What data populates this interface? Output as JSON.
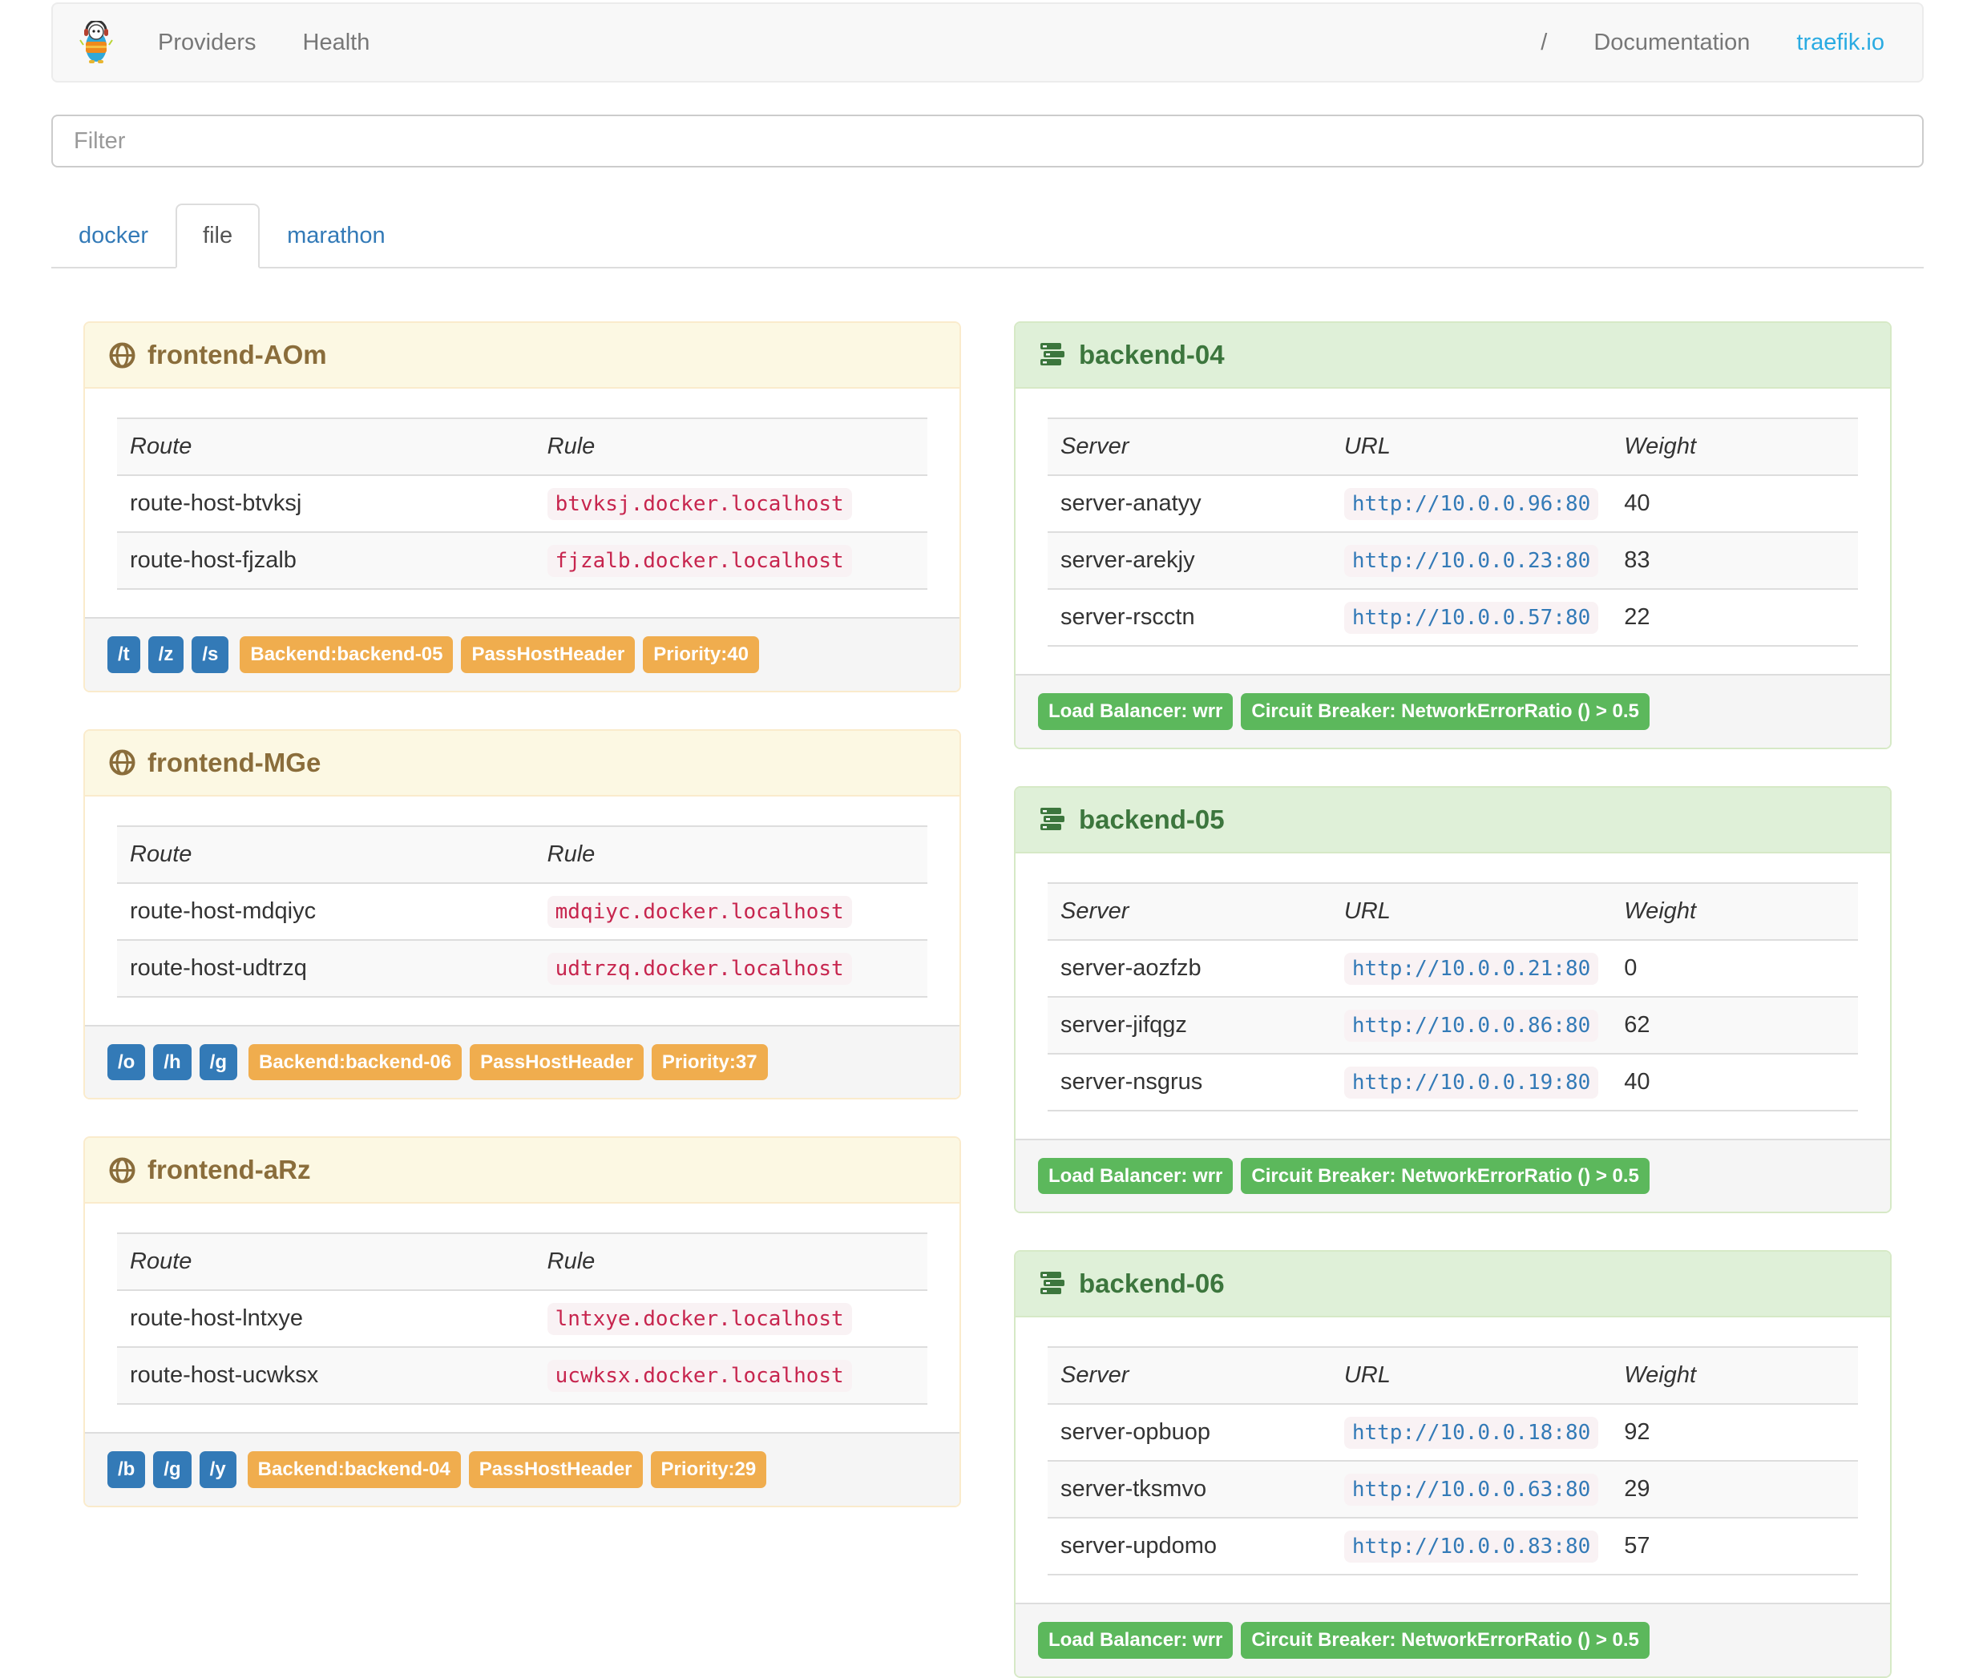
{
  "navbar": {
    "links": [
      {
        "label": "Providers"
      },
      {
        "label": "Health"
      }
    ],
    "right_links": [
      {
        "label": "/"
      },
      {
        "label": "Documentation"
      },
      {
        "label": "traefik.io",
        "accent": true
      }
    ]
  },
  "filter": {
    "placeholder": "Filter"
  },
  "tabs": [
    {
      "label": "docker",
      "active": false
    },
    {
      "label": "file",
      "active": true
    },
    {
      "label": "marathon",
      "active": false
    }
  ],
  "frontends": [
    {
      "title": "frontend-AOm",
      "columns": [
        "Route",
        "Rule"
      ],
      "routes": [
        {
          "route": "route-host-btvksj",
          "rule": "btvksj.docker.localhost"
        },
        {
          "route": "route-host-fjzalb",
          "rule": "fjzalb.docker.localhost"
        }
      ],
      "entry_points": [
        "/t",
        "/z",
        "/s"
      ],
      "labels": [
        "Backend:backend-05",
        "PassHostHeader",
        "Priority:40"
      ]
    },
    {
      "title": "frontend-MGe",
      "columns": [
        "Route",
        "Rule"
      ],
      "routes": [
        {
          "route": "route-host-mdqiyc",
          "rule": "mdqiyc.docker.localhost"
        },
        {
          "route": "route-host-udtrzq",
          "rule": "udtrzq.docker.localhost"
        }
      ],
      "entry_points": [
        "/o",
        "/h",
        "/g"
      ],
      "labels": [
        "Backend:backend-06",
        "PassHostHeader",
        "Priority:37"
      ]
    },
    {
      "title": "frontend-aRz",
      "columns": [
        "Route",
        "Rule"
      ],
      "routes": [
        {
          "route": "route-host-lntxye",
          "rule": "lntxye.docker.localhost"
        },
        {
          "route": "route-host-ucwksx",
          "rule": "ucwksx.docker.localhost"
        }
      ],
      "entry_points": [
        "/b",
        "/g",
        "/y"
      ],
      "labels": [
        "Backend:backend-04",
        "PassHostHeader",
        "Priority:29"
      ]
    }
  ],
  "backends": [
    {
      "title": "backend-04",
      "columns": [
        "Server",
        "URL",
        "Weight"
      ],
      "servers": [
        {
          "name": "server-anatyy",
          "url": "http://10.0.0.96:80",
          "weight": "40"
        },
        {
          "name": "server-arekjy",
          "url": "http://10.0.0.23:80",
          "weight": "83"
        },
        {
          "name": "server-rscctn",
          "url": "http://10.0.0.57:80",
          "weight": "22"
        }
      ],
      "footer_labels": [
        "Load Balancer: wrr",
        "Circuit Breaker: NetworkErrorRatio () > 0.5"
      ]
    },
    {
      "title": "backend-05",
      "columns": [
        "Server",
        "URL",
        "Weight"
      ],
      "servers": [
        {
          "name": "server-aozfzb",
          "url": "http://10.0.0.21:80",
          "weight": "0"
        },
        {
          "name": "server-jifqgz",
          "url": "http://10.0.0.86:80",
          "weight": "62"
        },
        {
          "name": "server-nsgrus",
          "url": "http://10.0.0.19:80",
          "weight": "40"
        }
      ],
      "footer_labels": [
        "Load Balancer: wrr",
        "Circuit Breaker: NetworkErrorRatio () > 0.5"
      ]
    },
    {
      "title": "backend-06",
      "columns": [
        "Server",
        "URL",
        "Weight"
      ],
      "servers": [
        {
          "name": "server-opbuop",
          "url": "http://10.0.0.18:80",
          "weight": "92"
        },
        {
          "name": "server-tksmvo",
          "url": "http://10.0.0.63:80",
          "weight": "29"
        },
        {
          "name": "server-updomo",
          "url": "http://10.0.0.83:80",
          "weight": "57"
        }
      ],
      "footer_labels": [
        "Load Balancer: wrr",
        "Circuit Breaker: NetworkErrorRatio () > 0.5"
      ]
    }
  ],
  "colors": {
    "accent_link": "#2aabe2",
    "link_blue": "#337ab7",
    "label_primary": "#337ab7",
    "label_warning": "#f0ad4e",
    "label_success": "#5cb85c",
    "frontend_heading_bg": "#fcf8e3",
    "frontend_heading_text": "#8a6d3b",
    "backend_heading_bg": "#dff0d8",
    "backend_heading_text": "#3c763d",
    "code_pink": "#c7254e"
  }
}
